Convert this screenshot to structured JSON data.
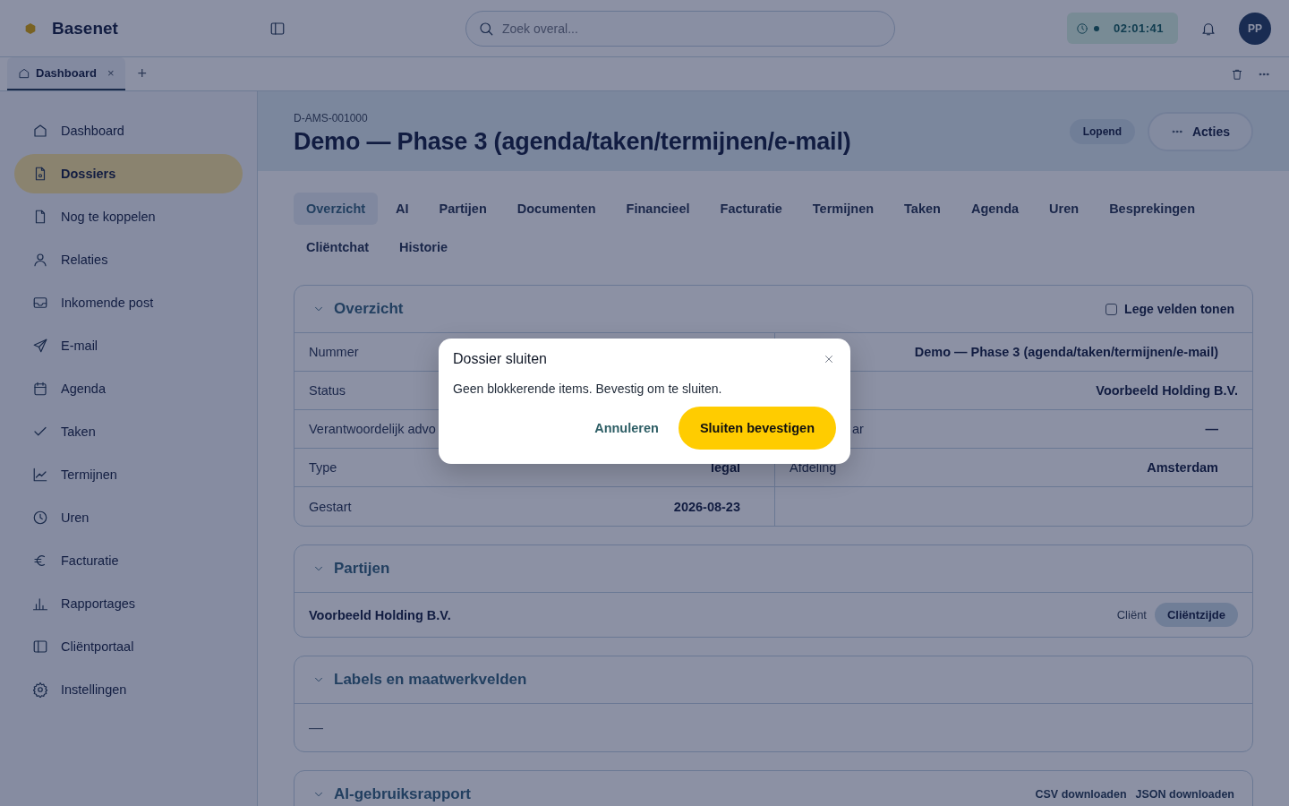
{
  "header": {
    "brand": "Basenet",
    "search": {
      "placeholder": "Zoek overal..."
    },
    "timer": {
      "time": "02:01:41",
      "running": true
    },
    "avatar": "PP"
  },
  "open_tabs": {
    "tabs": [
      {
        "label": "Dashboard",
        "close": "×",
        "selected": true
      }
    ],
    "add": "+"
  },
  "sidebar": {
    "items": [
      {
        "label": "Dashboard",
        "selected": false
      },
      {
        "label": "Dossiers",
        "selected": true
      },
      {
        "label": "Nog te koppelen",
        "selected": false
      },
      {
        "label": "Relaties",
        "selected": false
      },
      {
        "label": "Inkomende post",
        "selected": false
      },
      {
        "label": "E-mail",
        "selected": false
      },
      {
        "label": "Agenda",
        "selected": false
      },
      {
        "label": "Taken",
        "selected": false
      },
      {
        "label": "Termijnen",
        "selected": false
      },
      {
        "label": "Uren",
        "selected": false
      },
      {
        "label": "Facturatie",
        "selected": false
      },
      {
        "label": "Rapportages",
        "selected": false
      },
      {
        "label": "Cliëntportaal",
        "selected": false
      },
      {
        "label": "Instellingen",
        "selected": false
      }
    ]
  },
  "dossier": {
    "code": "D-AMS-001000",
    "title": "Demo — Phase 3 (agenda/taken/termijnen/e-mail)",
    "status": "Lopend",
    "actions": "Acties"
  },
  "tabs": [
    {
      "label": "Overzicht",
      "selected": true
    },
    {
      "label": "AI",
      "selected": false
    },
    {
      "label": "Partijen",
      "selected": false
    },
    {
      "label": "Documenten",
      "selected": false
    },
    {
      "label": "Financieel",
      "selected": false
    },
    {
      "label": "Facturatie",
      "selected": false
    },
    {
      "label": "Termijnen",
      "selected": false
    },
    {
      "label": "Taken",
      "selected": false
    },
    {
      "label": "Agenda",
      "selected": false
    },
    {
      "label": "Uren",
      "selected": false
    },
    {
      "label": "Besprekingen",
      "selected": false
    },
    {
      "label": "Cliëntchat",
      "selected": false
    },
    {
      "label": "Historie",
      "selected": false
    }
  ],
  "overview": {
    "title": "Overzicht",
    "expanded": true,
    "empty_fields": {
      "label": "Lege velden tonen",
      "checked": false
    },
    "rows": [
      [
        {
          "label": "Nummer"
        },
        {
          "value": "Demo — Phase 3 (agenda/taken/termijnen/e-mail)",
          "kind": "plain"
        }
      ],
      [
        {
          "label": "Status"
        },
        {
          "value": "Voorbeeld Holding B.V.",
          "kind": "wide"
        }
      ],
      [
        {
          "label": "Verantwoordelijk advo"
        },
        {
          "label": "ar",
          "value": "—",
          "kind": "partial"
        }
      ],
      [
        {
          "label": "Type",
          "value": "legal"
        },
        {
          "label": "Afdeling",
          "value": "Amsterdam",
          "kind": "plain"
        }
      ],
      [
        {
          "label": "Gestart",
          "value": "2026-08-23"
        }
      ]
    ]
  },
  "parties": {
    "title": "Partijen",
    "expanded": true,
    "rows": [
      {
        "name": "Voorbeeld Holding B.V.",
        "role": "Cliënt",
        "side": "Cliëntzijde"
      }
    ]
  },
  "labels": {
    "title": "Labels en maatwerkvelden",
    "expanded": true,
    "empty": "—"
  },
  "ai_report": {
    "title": "AI-gebruiksrapport",
    "expanded": true,
    "links": [
      "CSV downloaden",
      "JSON downloaden"
    ]
  },
  "modal": {
    "title": "Dossier sluiten",
    "message": "Geen blokkerende items. Bevestig om te sluiten.",
    "cancel": "Annuleren",
    "confirm": "Sluiten bevestigen"
  }
}
